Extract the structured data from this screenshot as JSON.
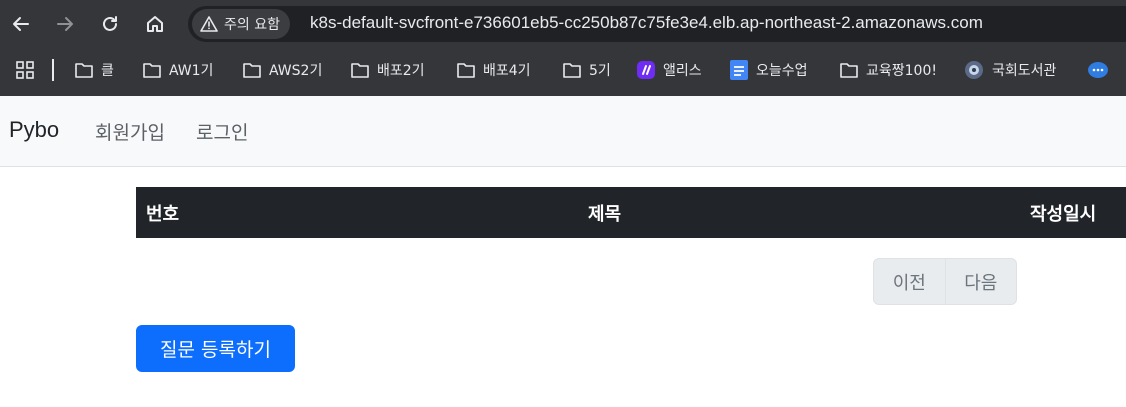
{
  "browser": {
    "security_label": "주의 요함",
    "url": "k8s-default-svcfront-e736601eb5-cc250b87c75fe3e4.elb.ap-northeast-2.amazonaws.com",
    "nav_icons": [
      "back-arrow-icon",
      "forward-arrow-icon",
      "reload-icon",
      "home-icon"
    ],
    "bookmarks": [
      {
        "label": "클",
        "icon": "folder-icon"
      },
      {
        "label": "AW1기",
        "icon": "folder-icon"
      },
      {
        "label": "AWS2기",
        "icon": "folder-icon"
      },
      {
        "label": "배포2기",
        "icon": "folder-icon"
      },
      {
        "label": "배포4기",
        "icon": "folder-icon"
      },
      {
        "label": "5기",
        "icon": "folder-icon"
      },
      {
        "label": "앨리스",
        "icon": "elice-icon"
      },
      {
        "label": "오늘수업",
        "icon": "docs-icon"
      },
      {
        "label": "교육짱100!",
        "icon": "folder-icon"
      },
      {
        "label": "국회도서관",
        "icon": "library-icon"
      }
    ]
  },
  "navbar": {
    "brand": "Pybo",
    "links": [
      "회원가입",
      "로그인"
    ]
  },
  "table": {
    "headers": [
      "번호",
      "제목",
      "작성일시"
    ],
    "rows": []
  },
  "pagination": {
    "prev_label": "이전",
    "next_label": "다음"
  },
  "actions": {
    "register_label": "질문 등록하기"
  },
  "colors": {
    "chrome_bg": "#35363a",
    "navbar_bg": "#f8f9fa",
    "table_header_bg": "#212529",
    "primary": "#0d6efd"
  }
}
